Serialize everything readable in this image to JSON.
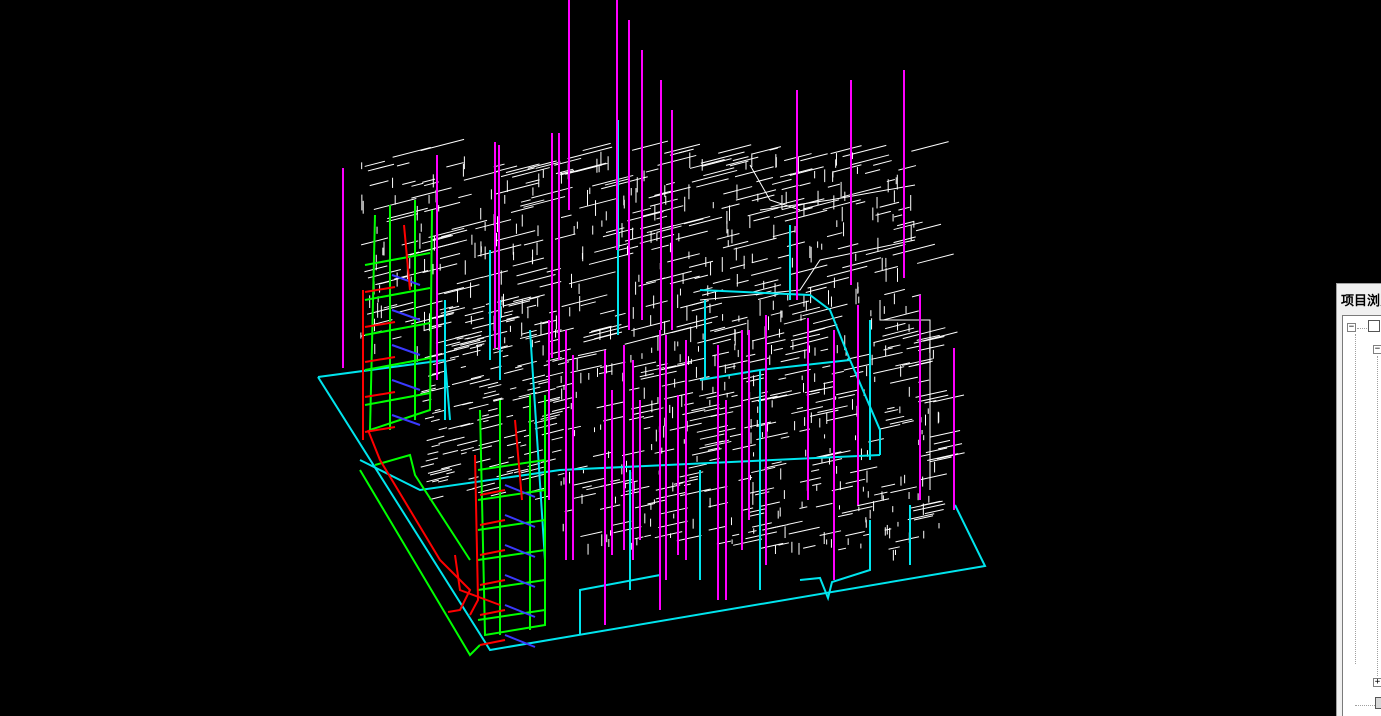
{
  "viewport": {
    "background": "#000000",
    "colors": {
      "cyan": "#00e5ee",
      "magenta": "#ff00ff",
      "white": "#ffffff",
      "green": "#00ff00",
      "red": "#ff0000",
      "blue": "#3a3aff"
    }
  },
  "project_browser": {
    "title": "项目浏览器",
    "tree": [
      {
        "toggle": "−",
        "icon": "view-root-icon"
      },
      {
        "toggle": "−",
        "icon": ""
      },
      {
        "toggle": "+",
        "icon": "sheet-icon"
      }
    ]
  }
}
